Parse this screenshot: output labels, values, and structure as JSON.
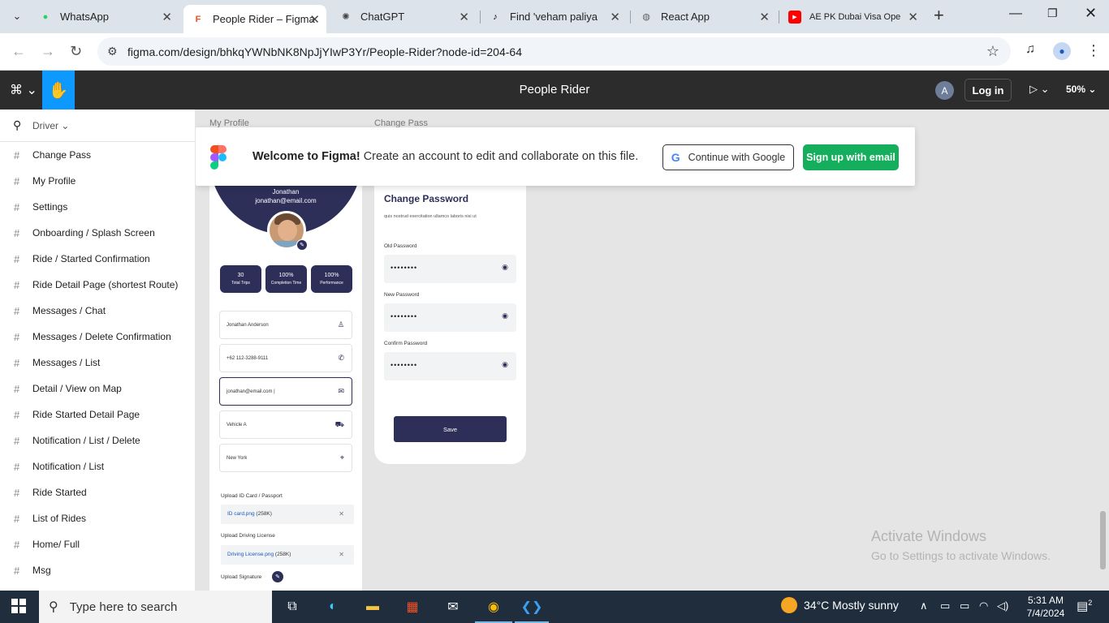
{
  "browser": {
    "tabs": [
      {
        "title": "WhatsApp",
        "icon": "whatsapp-icon",
        "color": "#25d366"
      },
      {
        "title": "People Rider – Figma",
        "icon": "figma-icon",
        "color": "#f24e1e"
      },
      {
        "title": "ChatGPT",
        "icon": "chatgpt-icon",
        "color": "#444444"
      },
      {
        "title": "Find 'veham paliya si",
        "icon": "tiktok-icon",
        "color": "#000000"
      },
      {
        "title": "React App",
        "icon": "globe-icon",
        "color": "#5f6368"
      },
      {
        "title": "AE PK Dubai Visa Ope",
        "icon": "youtube-icon",
        "color": "#ff0000"
      }
    ],
    "url": "figma.com/design/bhkqYWNbNK8NpJjYIwP3Yr/People-Rider?node-id=204-64"
  },
  "figma": {
    "file_title": "People Rider",
    "avatar_letter": "A",
    "login_label": "Log in",
    "zoom": "50%",
    "search_label": "Driver",
    "pages": [
      "Change Pass",
      "My Profile",
      "Settings",
      "Onboarding / Splash Screen",
      "Ride / Started Confirmation",
      "Ride Detail Page (shortest Route)",
      "Messages / Chat",
      "Messages / Delete Confirmation",
      "Messages / List",
      "Detail / View on Map",
      "Ride Started Detail Page",
      "Notification / List / Delete",
      "Notification / List",
      "Ride Started",
      "List of Rides",
      "Home/ Full",
      "Msg"
    ],
    "frame_labels": {
      "profile": "My Profile",
      "pass": "Change Pass"
    },
    "banner": {
      "bold": "Welcome to Figma!",
      "text": "Create an account to edit and collaborate on this file.",
      "google_button": "Continue with Google",
      "signup_button": "Sign up with email"
    },
    "accent": "#14ae5c"
  },
  "profile": {
    "name": "Jonathan",
    "email": "jonathan@email.com",
    "stats": [
      {
        "value": "30",
        "label": "Total Trips"
      },
      {
        "value": "100%",
        "label": "Completion Time"
      },
      {
        "value": "100%",
        "label": "Performance"
      }
    ],
    "fields": [
      "Jonathan Anderson",
      "+62 112-3288-9111",
      "jonathan@email.com |",
      "Vehicle A",
      "New York"
    ],
    "uploads": [
      {
        "label": "Upload ID Card / Passport",
        "file": "ID card.png",
        "size": "(258K)"
      },
      {
        "label": "Upload Driving License",
        "file": "Driving License.png",
        "size": "(258K)"
      }
    ],
    "signature_label": "Upload Signature",
    "brand_color": "#2d2f58"
  },
  "change_password": {
    "title": "Change Password",
    "subtitle": "quis nostrud exercitation ullamco laboris nisi ut",
    "fields": [
      {
        "label": "Old Password",
        "value": "••••••••"
      },
      {
        "label": "New Password",
        "value": "••••••••"
      },
      {
        "label": "Confirm Password",
        "value": "••••••••"
      }
    ],
    "save_label": "Save"
  },
  "watermark": {
    "line1": "Activate Windows",
    "line2": "Go to Settings to activate Windows."
  },
  "taskbar": {
    "search_placeholder": "Type here to search",
    "weather": "34°C  Mostly sunny",
    "time": "5:31 AM",
    "date": "7/4/2024",
    "notifications": "2"
  }
}
